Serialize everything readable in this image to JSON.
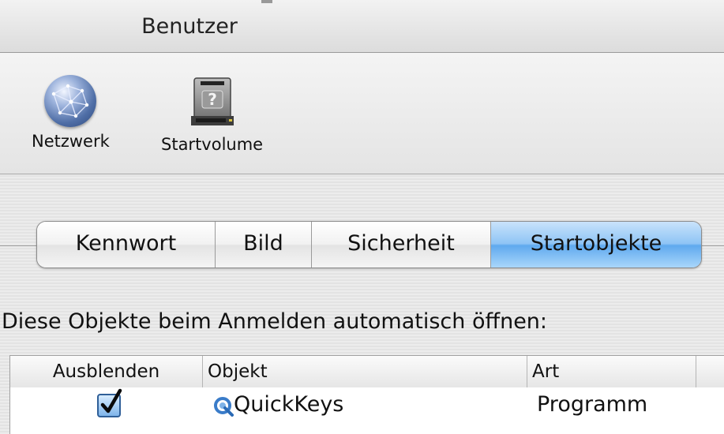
{
  "window": {
    "title": "Benutzer"
  },
  "toolbar": {
    "items": [
      {
        "label": "Netzwerk",
        "icon": "globe-icon"
      },
      {
        "label": "Startvolume",
        "icon": "disk-icon"
      }
    ]
  },
  "tabs": [
    {
      "label": "Kennwort",
      "active": false
    },
    {
      "label": "Bild",
      "active": false
    },
    {
      "label": "Sicherheit",
      "active": false
    },
    {
      "label": "Startobjekte",
      "active": true
    }
  ],
  "startup": {
    "heading": "Diese Objekte beim Anmelden automatisch öffnen:",
    "columns": [
      "Ausblenden",
      "Objekt",
      "Art"
    ],
    "rows": [
      {
        "hide": true,
        "name": "QuickKeys",
        "kind": "Programm",
        "icon": "quickkeys-icon"
      }
    ]
  },
  "colors": {
    "accent": "#5fa9ee",
    "checkbox": "#2f5f98"
  }
}
